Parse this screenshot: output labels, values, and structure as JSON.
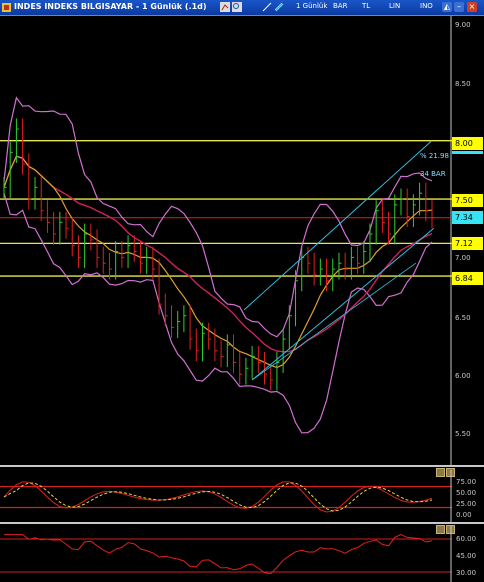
{
  "window": {
    "title": "INDES INDEKS BILGISAYAR - 1 Günlük (.1d)",
    "toolbar": [
      "1 Günlük",
      "BAR",
      "TL",
      "LIN",
      "INO"
    ],
    "accent": "#1a56c8"
  },
  "price_axis": {
    "ticks": [
      "8.00",
      "8.50",
      "6.50",
      "6.00",
      "5.50",
      "7.00"
    ],
    "tick_values": [
      9.0,
      8.5,
      6.5,
      6.0,
      5.5,
      7.0
    ],
    "tick_labels": [
      "9.00",
      "8.50",
      "6.50",
      "6.00",
      "5.50",
      "7.00"
    ]
  },
  "levels": [
    {
      "label": "8.00",
      "value": 8.0,
      "box_color": "#ffff00"
    },
    {
      "label": "7.50",
      "value": 7.5,
      "box_color": "#ffff00"
    },
    {
      "label": "7.34",
      "value": 7.34,
      "box_color": "#37e3f5"
    },
    {
      "label": "7.12",
      "value": 7.12,
      "box_color": "#ffff00"
    },
    {
      "label": "6.84",
      "value": 6.84,
      "box_color": "#ffff00"
    }
  ],
  "channel_annotation": {
    "percent": "% 21.98",
    "bars": "34 BAR"
  },
  "oscillator": {
    "ticks": [
      "75.00",
      "50.00",
      "25.00",
      "0.00"
    ]
  },
  "rsi": {
    "ticks": [
      "60.00",
      "45.00",
      "30.00"
    ]
  },
  "chart_data": {
    "type": "line",
    "price_close": [
      7.6,
      7.9,
      8.1,
      7.8,
      7.5,
      7.6,
      7.4,
      7.3,
      7.2,
      7.3,
      7.25,
      7.1,
      7.0,
      7.2,
      7.15,
      7.0,
      6.95,
      6.9,
      7.05,
      7.0,
      7.1,
      7.05,
      6.95,
      7.0,
      6.9,
      6.6,
      6.5,
      6.4,
      6.45,
      6.5,
      6.3,
      6.2,
      6.35,
      6.3,
      6.2,
      6.15,
      6.25,
      6.1,
      6.0,
      6.05,
      6.15,
      6.1,
      6.0,
      5.95,
      6.1,
      6.3,
      6.5,
      6.8,
      7.0,
      6.95,
      6.85,
      6.9,
      6.8,
      6.9,
      6.95,
      6.9,
      7.0,
      6.95,
      7.05,
      7.2,
      7.4,
      7.3,
      7.2,
      7.45,
      7.5,
      7.35,
      7.45,
      7.55,
      7.4,
      7.34
    ],
    "series_colors": {
      "bollinger": "#d070d0",
      "ma_fast": "#e0a030",
      "ma_slow": "#d02060",
      "bars_up": "#30d030",
      "bars_down": "#e02020",
      "channel": "#30c0e0"
    }
  }
}
